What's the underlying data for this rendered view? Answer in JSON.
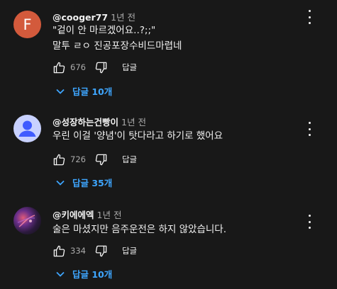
{
  "comments": [
    {
      "avatar_letter": "F",
      "author": "@cooger77",
      "time": "1년 전",
      "lines": [
        "\"겉이 안 마르겠어요..?;;\"",
        "말투 ㄹㅇ 진공포장수비드마렵네"
      ],
      "likes": "676",
      "reply_label": "답글",
      "replies_label": "답글 10개"
    },
    {
      "author": "@성장하는건빵이",
      "time": "1년 전",
      "lines": [
        "우린 이걸 '양념'이 탓다라고 하기로 했어요"
      ],
      "likes": "726",
      "reply_label": "답글",
      "replies_label": "답글 35개"
    },
    {
      "author": "@키에에엑",
      "time": "1년 전",
      "lines": [
        "술은 마셨지만 음주운전은 하지 않았습니다."
      ],
      "likes": "334",
      "reply_label": "답글",
      "replies_label": "답글 10개"
    }
  ]
}
